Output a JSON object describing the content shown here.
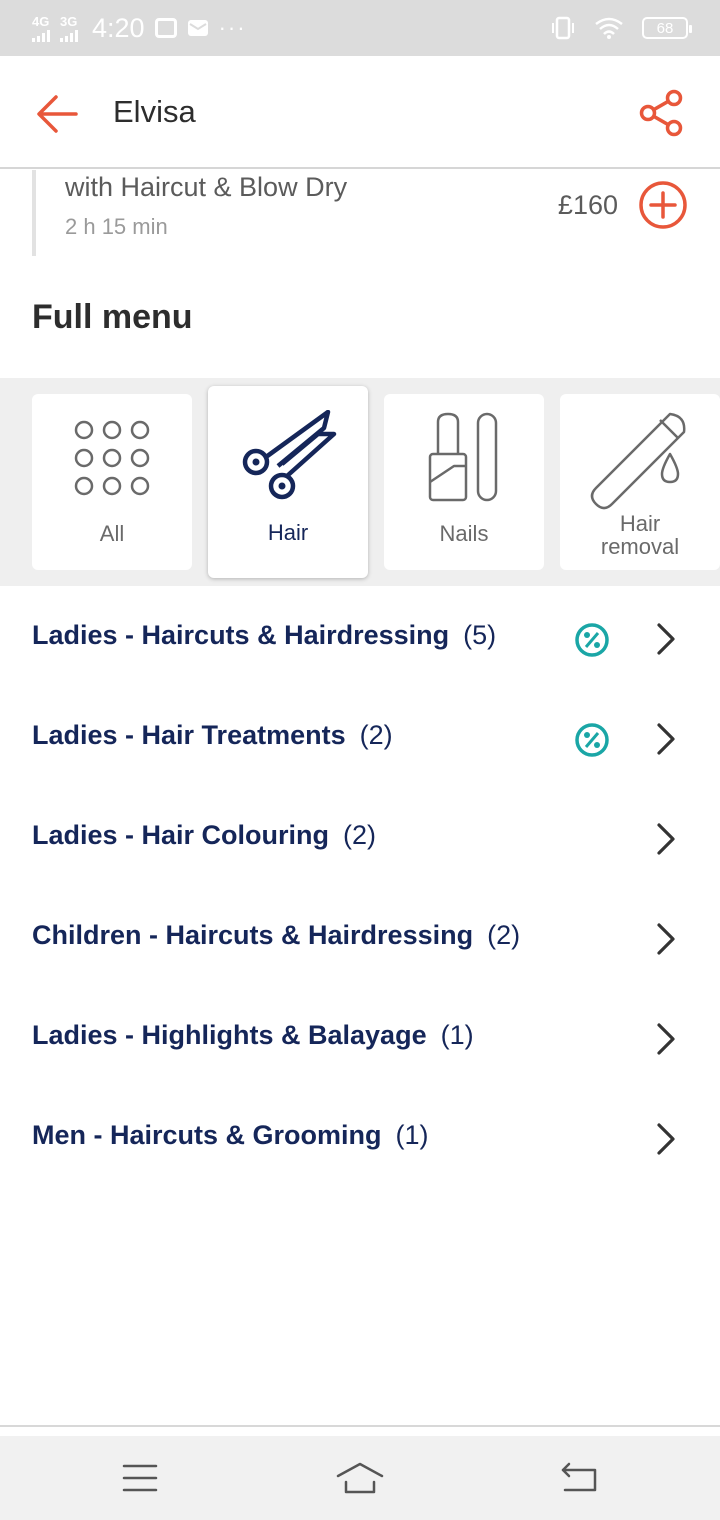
{
  "status_bar": {
    "network_1": "4G",
    "network_2": "3G",
    "time": "4:20",
    "more": "···",
    "battery": "68"
  },
  "header": {
    "title": "Elvisa"
  },
  "service": {
    "name": "with Haircut & Blow Dry",
    "duration": "2 h 15 min",
    "price": "£160"
  },
  "section": {
    "title": "Full menu"
  },
  "categories": [
    {
      "label": "All",
      "selected": false
    },
    {
      "label": "Hair",
      "selected": true
    },
    {
      "label": "Nails",
      "selected": false
    },
    {
      "label": "Hair\nremoval",
      "selected": false
    }
  ],
  "menu_items": [
    {
      "label": "Ladies - Haircuts & Hairdressing",
      "count": "(5)",
      "discount": true
    },
    {
      "label": "Ladies - Hair Treatments",
      "count": "(2)",
      "discount": true
    },
    {
      "label": "Ladies - Hair Colouring",
      "count": "(2)",
      "discount": false
    },
    {
      "label": "Children - Haircuts & Hairdressing",
      "count": "(2)",
      "discount": false
    },
    {
      "label": "Ladies - Highlights & Balayage",
      "count": "(1)",
      "discount": false
    },
    {
      "label": "Men - Haircuts & Grooming",
      "count": "(1)",
      "discount": false
    }
  ],
  "colors": {
    "accent": "#e8573a",
    "navy": "#152659",
    "teal": "#1aa6a6",
    "status_bar": "#dcdcdc"
  },
  "icons": {
    "back": "arrow-left-icon",
    "share": "share-icon",
    "add": "plus-circle-icon",
    "all": "grid-dots-icon",
    "hair": "scissors-icon",
    "nails": "nail-polish-icon",
    "hair_removal": "razor-drop-icon",
    "discount": "percent-badge-icon",
    "chevron": "chevron-right-icon",
    "nav_menu": "menu-icon",
    "nav_home": "home-icon",
    "nav_back": "back-icon"
  }
}
